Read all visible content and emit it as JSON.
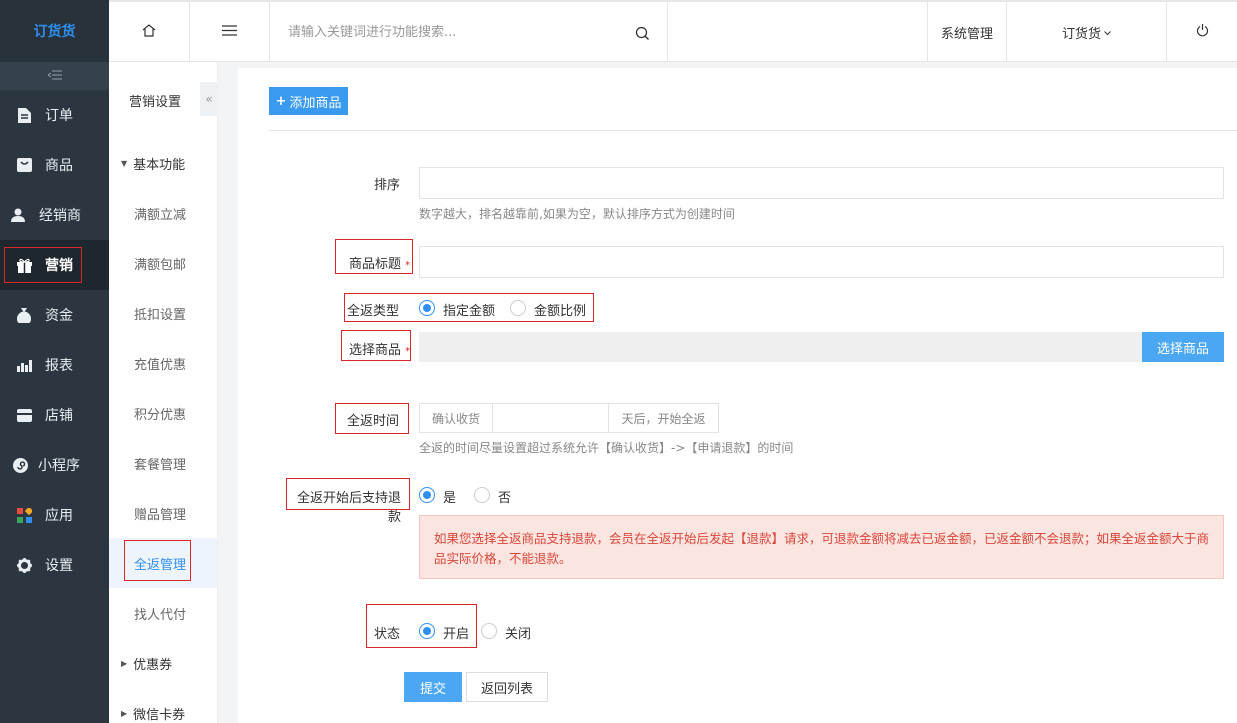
{
  "app": {
    "logo": "订货货"
  },
  "sidebar": {
    "collapse_icon": "list-collapse-icon",
    "items": [
      {
        "label": "订单",
        "icon": "document-icon"
      },
      {
        "label": "商品",
        "icon": "goods-icon"
      },
      {
        "label": "经销商",
        "icon": "user-icon"
      },
      {
        "label": "营销",
        "icon": "gift-icon",
        "active": true
      },
      {
        "label": "资金",
        "icon": "money-bag-icon"
      },
      {
        "label": "报表",
        "icon": "bar-chart-icon"
      },
      {
        "label": "店铺",
        "icon": "store-icon"
      },
      {
        "label": "小程序",
        "icon": "mini-program-icon"
      },
      {
        "label": "应用",
        "icon": "apps-icon"
      },
      {
        "label": "设置",
        "icon": "gear-icon"
      }
    ]
  },
  "subnav": {
    "title": "营销设置",
    "group_basic": "基本功能",
    "items": [
      "满额立减",
      "满额包邮",
      "抵扣设置",
      "充值优惠",
      "积分优惠",
      "套餐管理",
      "赠品管理",
      "全返管理",
      "找人代付"
    ],
    "group_coupon": "优惠券",
    "group_wechat": "微信卡券"
  },
  "topbar": {
    "search_placeholder": "请输入关键词进行功能搜索...",
    "system": "系统管理",
    "account": "订货货"
  },
  "toolbar": {
    "add_label": "添加商品"
  },
  "form": {
    "sort_label": "排序",
    "sort_hint": "数字越大，排名越靠前,如果为空，默认排序方式为创建时间",
    "title_label": "商品标题",
    "type_label": "全返类型",
    "type_opt1": "指定金额",
    "type_opt2": "金额比例",
    "goods_label": "选择商品",
    "goods_btn": "选择商品",
    "time_label": "全返时间",
    "time_prefix": "确认收货",
    "time_suffix": "天后，开始全返",
    "time_hint": "全返的时间尽量设置超过系统允许【确认收货】->【申请退款】的时间",
    "refund_label": "全返开始后支持退款",
    "refund_yes": "是",
    "refund_no": "否",
    "refund_alert": "如果您选择全返商品支持退款，会员在全返开始后发起【退款】请求，可退款金额将减去已返金额，已返金额不会退款；如果全返金额大于商品实际价格，不能退款。",
    "status_label": "状态",
    "status_on": "开启",
    "status_off": "关闭",
    "submit": "提交",
    "back": "返回列表"
  }
}
